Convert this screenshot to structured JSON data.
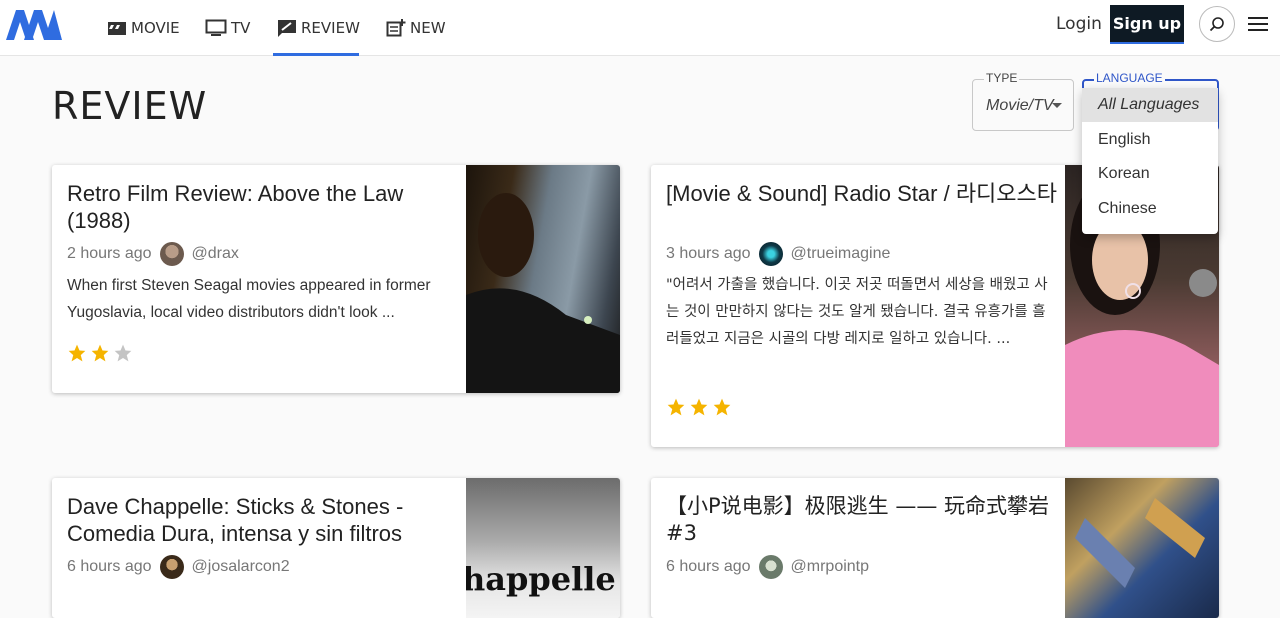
{
  "nav": {
    "items": [
      {
        "label": "MOVIE",
        "icon": "movie-clapper-icon"
      },
      {
        "label": "TV",
        "icon": "tv-icon"
      },
      {
        "label": "REVIEW",
        "icon": "review-pen-icon"
      },
      {
        "label": "NEW",
        "icon": "new-post-icon"
      }
    ],
    "active": "REVIEW",
    "login_label": "Login",
    "signup_label": "Sign up",
    "accent_color": "#2f6ce0"
  },
  "page": {
    "title": "REVIEW"
  },
  "filters": {
    "type": {
      "label": "TYPE",
      "value": "Movie/TV"
    },
    "language": {
      "label": "LANGUAGE",
      "options": [
        "All Languages",
        "English",
        "Korean",
        "Chinese"
      ],
      "selected": "All Languages"
    }
  },
  "reviews": [
    {
      "title": "Retro Film Review: Above the Law (1988)",
      "time": "2 hours ago",
      "author": "@drax",
      "excerpt": "When first Steven Seagal movies appeared in former Yugoslavia, local video distributors didn't look ...",
      "rating": 2,
      "max_rating": 3
    },
    {
      "title": "[Movie & Sound] Radio Star / 라디오스타",
      "time": "3 hours ago",
      "author": "@trueimagine",
      "excerpt": "\"어려서 가출을 했습니다. 이곳 저곳 떠돌면서 세상을 배웠고 사는 것이 만만하지 않다는 것도 알게 됐습니다. 결국 유흥가를 흘러들었고 지금은 시골의 다방 레지로 일하고 있습니다. ...",
      "rating": 3,
      "max_rating": 3
    },
    {
      "title": "Dave Chappelle: Sticks & Stones - Comedia Dura, intensa y sin filtros",
      "time": "6 hours ago",
      "author": "@josalarcon2",
      "thumb_text": "happelle"
    },
    {
      "title": "【小P说电影】极限逃生 —— 玩命式攀岩 #3",
      "time": "6 hours ago",
      "author": "@mrpointp"
    }
  ],
  "colors": {
    "star_on": "#f5b400",
    "star_off": "#c4c4c4",
    "signup_bg": "#0e1a24"
  }
}
